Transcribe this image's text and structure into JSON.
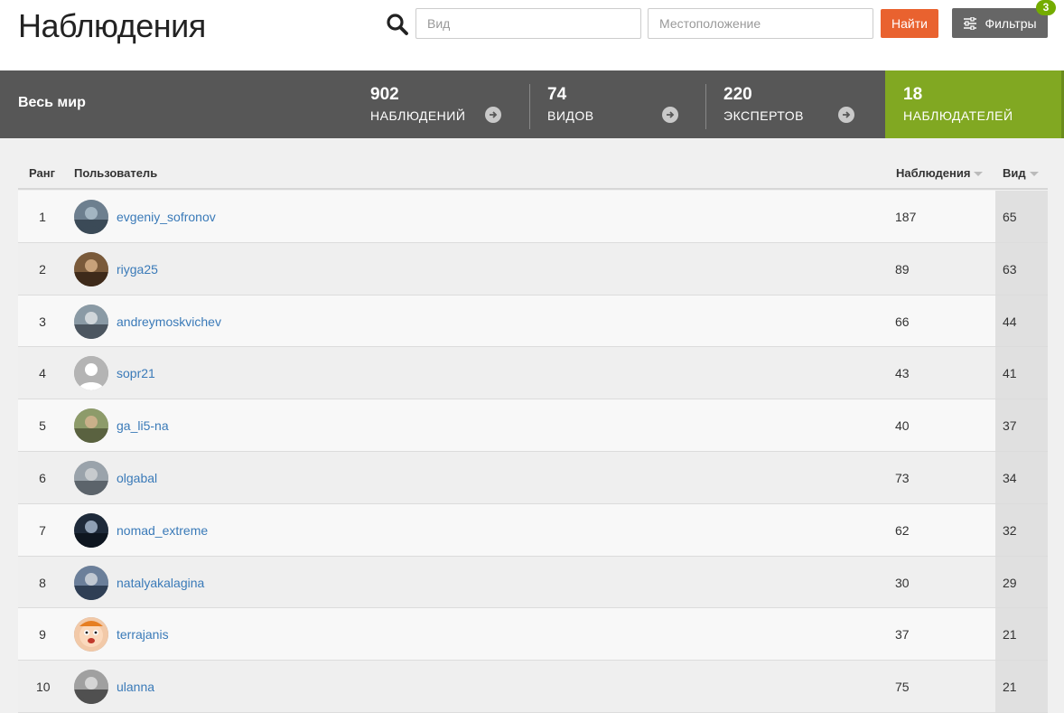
{
  "header": {
    "title": "Наблюдения",
    "taxon_placeholder": "Вид",
    "place_placeholder": "Местоположение",
    "go_label": "Найти",
    "filters_label": "Фильтры",
    "filters_count": "3"
  },
  "stats": {
    "place_name": "Весь мир",
    "observations": {
      "value": "902",
      "label": "НАБЛЮДЕНИЙ"
    },
    "species": {
      "value": "74",
      "label": "ВИДОВ"
    },
    "experts": {
      "value": "220",
      "label": "ЭКСПЕРТОВ"
    },
    "observers": {
      "value": "18",
      "label": "НАБЛЮДАТЕЛЕЙ"
    }
  },
  "colors": {
    "accent_orange": "#e9622f",
    "active_green": "#81a822",
    "stats_bg": "#575757",
    "link_blue": "#3a7ab8"
  },
  "table": {
    "columns": {
      "rank": "Ранг",
      "user": "Пользователь",
      "observations": "Наблюдения",
      "species": "Вид"
    },
    "rows": [
      {
        "rank": "1",
        "login": "evgeniy_sofronov",
        "observations": "187",
        "species": "65",
        "avatar": "photo-avatar"
      },
      {
        "rank": "2",
        "login": "riyga25",
        "observations": "89",
        "species": "63",
        "avatar": "photo-avatar"
      },
      {
        "rank": "3",
        "login": "andreymoskvichev",
        "observations": "66",
        "species": "44",
        "avatar": "photo-avatar"
      },
      {
        "rank": "4",
        "login": "sopr21",
        "observations": "43",
        "species": "41",
        "avatar": "default-user-icon"
      },
      {
        "rank": "5",
        "login": "ga_li5-na",
        "observations": "40",
        "species": "37",
        "avatar": "photo-avatar"
      },
      {
        "rank": "6",
        "login": "olgabal",
        "observations": "73",
        "species": "34",
        "avatar": "photo-avatar"
      },
      {
        "rank": "7",
        "login": "nomad_extreme",
        "observations": "62",
        "species": "32",
        "avatar": "photo-avatar"
      },
      {
        "rank": "8",
        "login": "natalyakalagina",
        "observations": "30",
        "species": "29",
        "avatar": "photo-avatar"
      },
      {
        "rank": "9",
        "login": "terrajanis",
        "observations": "37",
        "species": "21",
        "avatar": "cartoon-avatar"
      },
      {
        "rank": "10",
        "login": "ulanna",
        "observations": "75",
        "species": "21",
        "avatar": "photo-avatar"
      }
    ]
  }
}
